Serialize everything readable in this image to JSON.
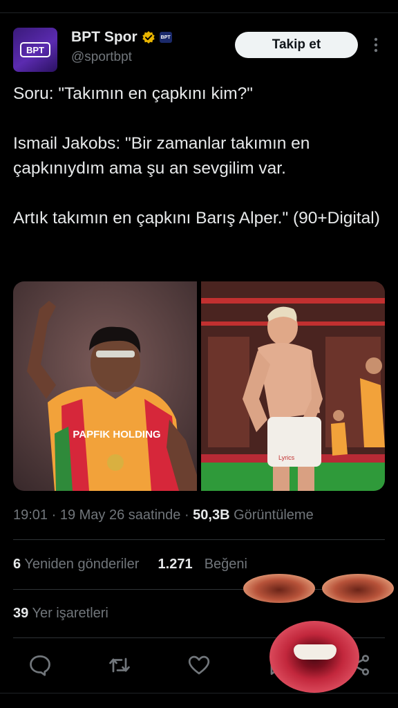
{
  "author": {
    "display_name": "BPT Spor",
    "handle": "@sportbpt",
    "avatar_text": "BPT",
    "affiliate_badge": "BPT",
    "verified": true
  },
  "follow_button": "Takip et",
  "tweet_text": "Soru: \"Takımın en çapkını kim?\"\n\nIsmail Jakobs: \"Bir zamanlar takımın en çapkınıydım ama şu an sevgilim var.\n\nArtık takımın en çapkını Barış Alper.\" (90+Digital)",
  "media": {
    "left_photo_text": "PAPFIK HOLDING",
    "right_photo_text": "Lyrics"
  },
  "meta": {
    "time": "19:01 · 19 May 26 saatinde · ",
    "views_count": "50,3B",
    "views_label": " Görüntüleme"
  },
  "stats": {
    "reposts_count": "6",
    "reposts_label": "Yeniden gönderiler",
    "likes_count": "1.271",
    "likes_label": "Beğeni",
    "bookmarks_count": "39",
    "bookmarks_label": "Yer işaretleri"
  },
  "colors": {
    "background": "#000000",
    "text": "#e7e9ea",
    "secondary_text": "#71767b",
    "verified_gold": "#e8b400",
    "accent_purple": "#5b2bb0"
  },
  "icons": [
    "reply-icon",
    "retweet-icon",
    "like-icon",
    "bookmark-icon",
    "share-icon",
    "more-icon",
    "verified-icon"
  ]
}
